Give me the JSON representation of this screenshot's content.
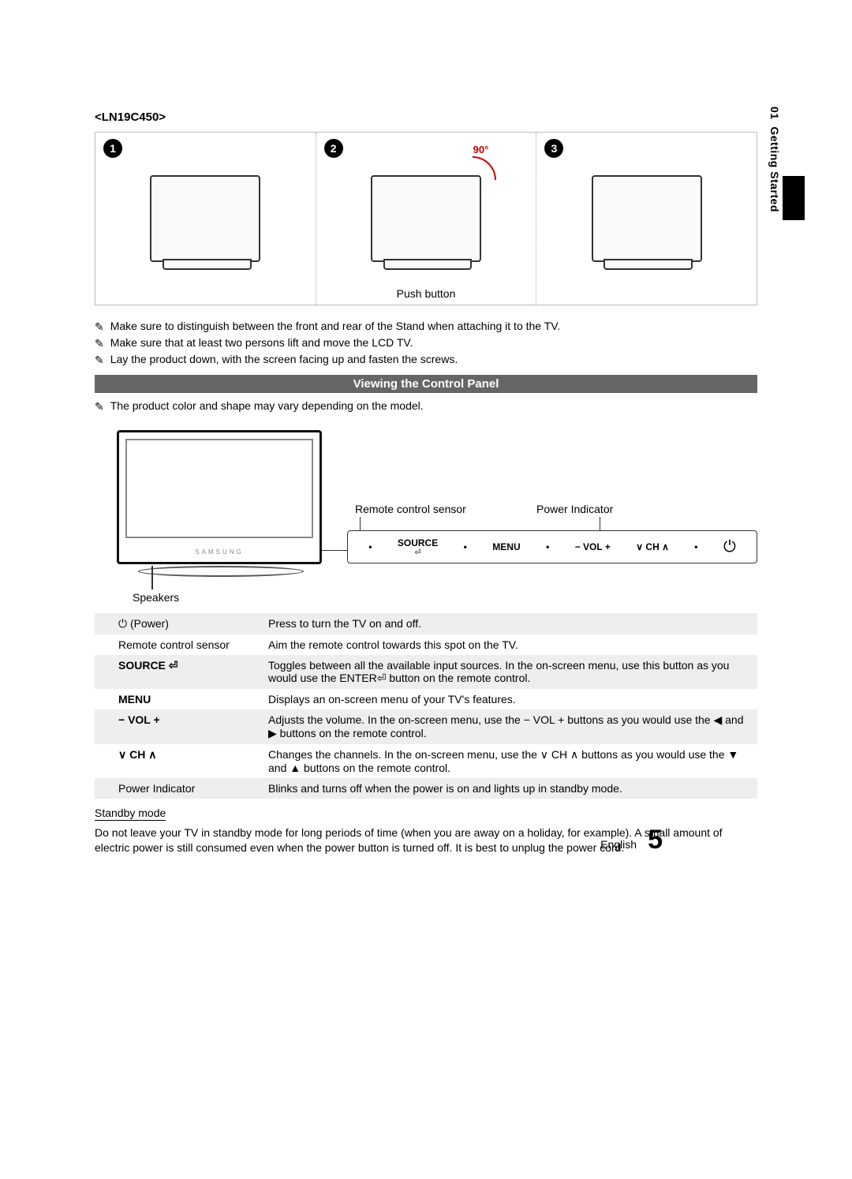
{
  "side_tab": {
    "chapter": "01",
    "title": "Getting Started"
  },
  "model": "<LN19C450>",
  "steps": {
    "s1": "1",
    "s2": "2",
    "s3": "3",
    "ninety": "90°",
    "push": "Push button"
  },
  "assembly_notes": [
    "Make sure to distinguish between the front and rear of the Stand when attaching it to the TV.",
    "Make sure that at least two persons lift and move the LCD TV.",
    "Lay the product down, with the screen facing up and fasten the screws."
  ],
  "section_title": "Viewing the Control Panel",
  "panel_note": "The product color and shape may vary depending on the model.",
  "callouts": {
    "remote": "Remote control sensor",
    "power": "Power Indicator",
    "speakers": "Speakers",
    "brand": "SAMSUNG"
  },
  "panel_buttons": {
    "source": "SOURCE",
    "source_sub": "⏎",
    "menu": "MENU",
    "vol": "− VOL +",
    "ch": "∨ CH ∧"
  },
  "table": [
    {
      "label": "⏻ (Power)",
      "desc": "Press to turn the TV on and off."
    },
    {
      "label": "Remote control sensor",
      "desc": "Aim the remote control towards this spot on the TV."
    },
    {
      "label": "SOURCE ⏎",
      "desc": "Toggles between all the available input sources. In the on-screen menu, use this button as you would use the ENTER⏎ button on the remote control."
    },
    {
      "label": "MENU",
      "desc": "Displays an on-screen menu of your TV's features."
    },
    {
      "label": "− VOL +",
      "desc": "Adjusts the volume. In the on-screen menu, use the − VOL + buttons as you would use the ◀ and ▶ buttons on the remote control."
    },
    {
      "label": "∨ CH ∧",
      "desc": "Changes the channels. In the on-screen menu, use the ∨ CH ∧ buttons as you would use the ▼ and ▲ buttons on the remote control."
    },
    {
      "label": "Power Indicator",
      "desc": "Blinks and turns off when the power is on and lights up in standby mode."
    }
  ],
  "standby": {
    "heading": "Standby mode",
    "body": "Do not leave your TV in standby mode for long periods of time (when you are away on a holiday, for example). A small amount of electric power is still consumed even when the power button is turned off. It is best to unplug the power cord."
  },
  "footer": {
    "lang": "English",
    "page": "5"
  }
}
